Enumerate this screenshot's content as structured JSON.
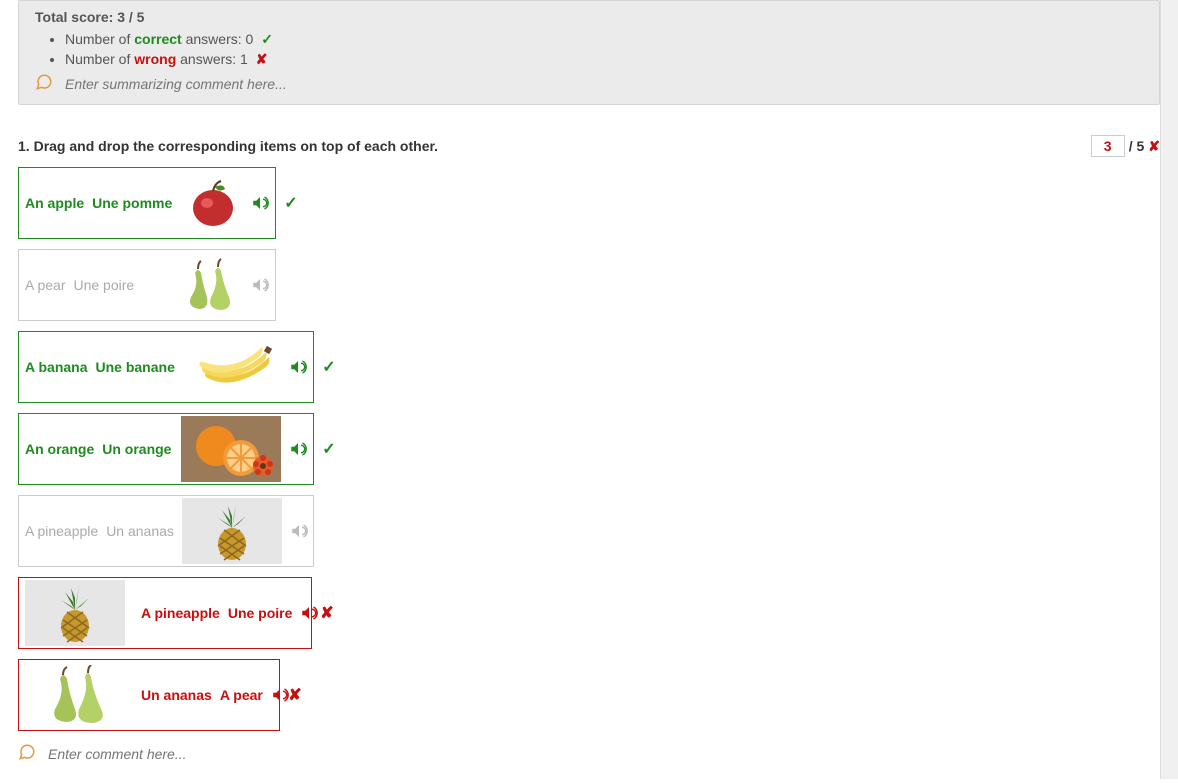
{
  "summary": {
    "title": "Total score: 3 / 5",
    "line1_prefix": "Number of ",
    "line1_word": "correct",
    "line1_suffix": " answers: 0",
    "line2_prefix": "Number of ",
    "line2_word": "wrong",
    "line2_suffix": " answers: 1",
    "comment_placeholder": "Enter summarizing comment here..."
  },
  "question": {
    "number": "1.",
    "text": "Drag and drop the corresponding items on top of each other.",
    "score_value": "3",
    "score_denom": "/ 5"
  },
  "items": [
    {
      "state": "correct",
      "english": "An apple",
      "french": "Une pomme",
      "fruit": "apple"
    },
    {
      "state": "blank",
      "english": "A pear",
      "french": "Une poire",
      "fruit": "pear"
    },
    {
      "state": "correct",
      "english": "A banana",
      "french": "Une banane",
      "fruit": "banana"
    },
    {
      "state": "correct",
      "english": "An orange",
      "french": "Un orange",
      "fruit": "orange"
    },
    {
      "state": "blank",
      "english": "A pineapple",
      "french": "Un ananas",
      "fruit": "pineapple_bg"
    },
    {
      "state": "wrong",
      "english": "A pineapple",
      "french": "Une poire",
      "fruit": "pineapple_bg",
      "imgFirst": true
    },
    {
      "state": "wrong",
      "english": "Un ananas",
      "french": "A pear",
      "fruit": "pear",
      "imgFirst": true
    }
  ],
  "bottom_comment_placeholder": "Enter comment here..."
}
